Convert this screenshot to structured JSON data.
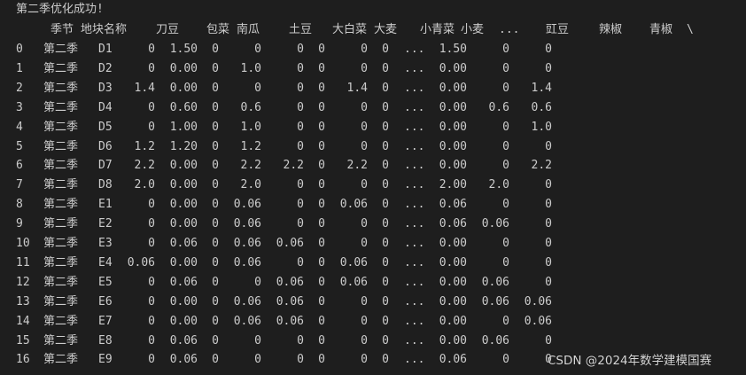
{
  "status_line": "第二季优化成功!",
  "header": {
    "season": "季节",
    "plot": "地块名称",
    "c1": "刀豆",
    "c2": "包菜",
    "c3": "南瓜",
    "c4": "土豆",
    "c5": "大白菜",
    "c6": "大麦",
    "c7": "小青菜",
    "c8": "小麦",
    "ellipsis": "...",
    "c9": "豇豆",
    "c10": "辣椒",
    "c11": "青椒",
    "continuation": "\\"
  },
  "rows": [
    [
      "0",
      "第二季",
      "D1",
      "0",
      "1.50",
      "0",
      "0",
      "0",
      "0",
      "0",
      "0",
      "...",
      "1.50",
      "0",
      "0"
    ],
    [
      "1",
      "第二季",
      "D2",
      "0",
      "0.00",
      "0",
      "1.0",
      "0",
      "0",
      "0",
      "0",
      "...",
      "0.00",
      "0",
      "0"
    ],
    [
      "2",
      "第二季",
      "D3",
      "1.4",
      "0.00",
      "0",
      "0",
      "0",
      "0",
      "1.4",
      "0",
      "...",
      "0.00",
      "0",
      "1.4"
    ],
    [
      "3",
      "第二季",
      "D4",
      "0",
      "0.60",
      "0",
      "0.6",
      "0",
      "0",
      "0",
      "0",
      "...",
      "0.00",
      "0.6",
      "0.6"
    ],
    [
      "4",
      "第二季",
      "D5",
      "0",
      "1.00",
      "0",
      "1.0",
      "0",
      "0",
      "0",
      "0",
      "...",
      "0.00",
      "0",
      "1.0"
    ],
    [
      "5",
      "第二季",
      "D6",
      "1.2",
      "1.20",
      "0",
      "1.2",
      "0",
      "0",
      "0",
      "0",
      "...",
      "0.00",
      "0",
      "0"
    ],
    [
      "6",
      "第二季",
      "D7",
      "2.2",
      "0.00",
      "0",
      "2.2",
      "2.2",
      "0",
      "2.2",
      "0",
      "...",
      "0.00",
      "0",
      "2.2"
    ],
    [
      "7",
      "第二季",
      "D8",
      "2.0",
      "0.00",
      "0",
      "2.0",
      "0",
      "0",
      "0",
      "0",
      "...",
      "2.00",
      "2.0",
      "0"
    ],
    [
      "8",
      "第二季",
      "E1",
      "0",
      "0.00",
      "0",
      "0.06",
      "0",
      "0",
      "0.06",
      "0",
      "...",
      "0.06",
      "0",
      "0"
    ],
    [
      "9",
      "第二季",
      "E2",
      "0",
      "0.00",
      "0",
      "0.06",
      "0",
      "0",
      "0",
      "0",
      "...",
      "0.06",
      "0.06",
      "0"
    ],
    [
      "10",
      "第二季",
      "E3",
      "0",
      "0.06",
      "0",
      "0.06",
      "0.06",
      "0",
      "0",
      "0",
      "...",
      "0.00",
      "0",
      "0"
    ],
    [
      "11",
      "第二季",
      "E4",
      "0.06",
      "0.00",
      "0",
      "0.06",
      "0",
      "0",
      "0.06",
      "0",
      "...",
      "0.00",
      "0",
      "0"
    ],
    [
      "12",
      "第二季",
      "E5",
      "0",
      "0.06",
      "0",
      "0",
      "0.06",
      "0",
      "0.06",
      "0",
      "...",
      "0.00",
      "0.06",
      "0"
    ],
    [
      "13",
      "第二季",
      "E6",
      "0",
      "0.00",
      "0",
      "0.06",
      "0.06",
      "0",
      "0",
      "0",
      "...",
      "0.00",
      "0.06",
      "0.06"
    ],
    [
      "14",
      "第二季",
      "E7",
      "0",
      "0.00",
      "0",
      "0.06",
      "0.06",
      "0",
      "0",
      "0",
      "...",
      "0.00",
      "0",
      "0.06"
    ],
    [
      "15",
      "第二季",
      "E8",
      "0",
      "0.06",
      "0",
      "0",
      "0",
      "0",
      "0",
      "0",
      "...",
      "0.00",
      "0.06",
      "0"
    ],
    [
      "16",
      "第二季",
      "E9",
      "0",
      "0.06",
      "0",
      "0",
      "0",
      "0",
      "0",
      "0",
      "...",
      "0.06",
      "0",
      "0"
    ]
  ],
  "watermark": "CSDN @2024年数学建模国赛"
}
